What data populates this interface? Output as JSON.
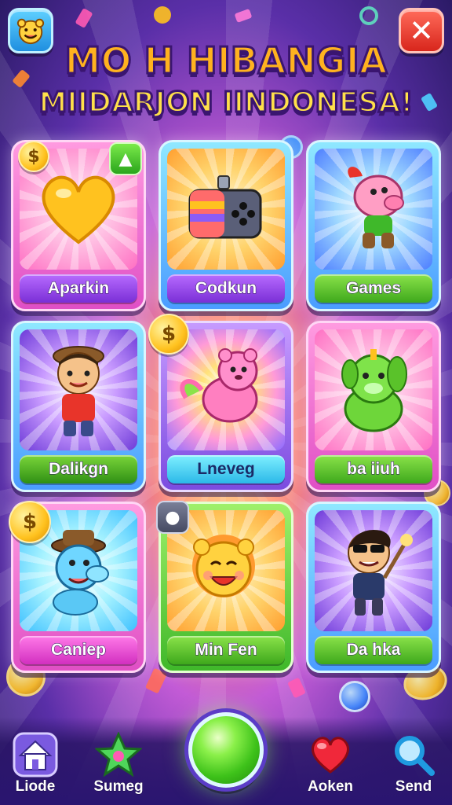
{
  "header": {
    "title_line1": "MO H HIBANGIA",
    "title_line2": "MIIDARJON IINDONESA!",
    "profile_icon": "smiley-face-icon",
    "close_icon": "close-icon"
  },
  "cards": [
    {
      "label": "Aparkin",
      "art": "golden-heart",
      "frame": "pink",
      "label_color": "purple"
    },
    {
      "label": "Codkun",
      "art": "game-controller-box",
      "frame": "blue",
      "label_color": "purple"
    },
    {
      "label": "Games",
      "art": "pink-pig-character",
      "frame": "blue",
      "label_color": "green"
    },
    {
      "label": "Dalikgn",
      "art": "boy-with-goggles",
      "frame": "blue",
      "label_color": "green"
    },
    {
      "label": "Lneveg",
      "art": "pink-bear-creature",
      "frame": "purple",
      "label_color": "cyan"
    },
    {
      "label": "ba iiuh",
      "art": "green-dog-creature",
      "frame": "pink",
      "label_color": "green"
    },
    {
      "label": "Caniep",
      "art": "blue-dog-with-hat",
      "frame": "pink",
      "label_color": "magenta"
    },
    {
      "label": "Min Fen",
      "art": "yellow-lion-cub",
      "frame": "blue",
      "label_color": "green"
    },
    {
      "label": "Da hka",
      "art": "boy-with-sunglasses",
      "frame": "blue",
      "label_color": "green"
    }
  ],
  "bottom_nav": [
    {
      "label": "Liode",
      "icon": "home-icon"
    },
    {
      "label": "Sumeg",
      "icon": "star-icon"
    },
    {
      "label": "",
      "icon": "play-orb-icon"
    },
    {
      "label": "Aoken",
      "icon": "heart-icon"
    },
    {
      "label": "Send",
      "icon": "search-icon"
    }
  ],
  "colors": {
    "background_center": "#ffd86b",
    "background_edge": "#2b1a66",
    "title_primary": "#ffb21f",
    "title_outline": "#3a1570",
    "close_red": "#d8261c",
    "play_green": "#3ec21a"
  }
}
